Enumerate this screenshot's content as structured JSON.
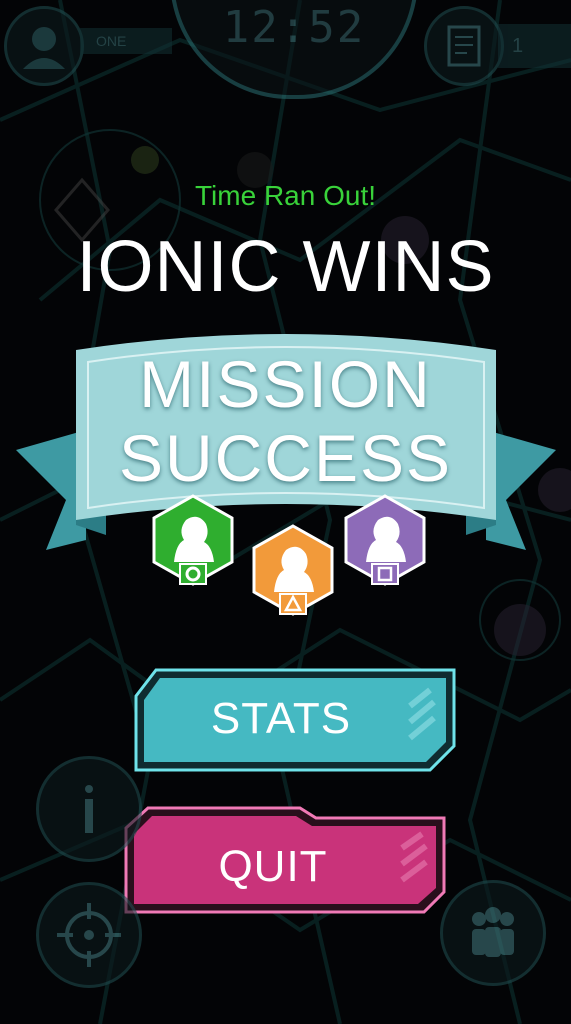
{
  "hud": {
    "clock": "12:52",
    "left_tag": "ONE",
    "right_tag": "1"
  },
  "result": {
    "reason": "Time Ran Out!",
    "winner": "IONIC WINS"
  },
  "banner": {
    "line1": "MISSION",
    "line2": "SUCCESS"
  },
  "badges": [
    {
      "shape_icon": "circle-icon",
      "color": "#2fae2f"
    },
    {
      "shape_icon": "triangle-icon",
      "color": "#f29a3a"
    },
    {
      "shape_icon": "square-icon",
      "color": "#8d6bb8"
    }
  ],
  "buttons": {
    "stats": "STATS",
    "quit": "QUIT"
  },
  "colors": {
    "teal": "#45b9c2",
    "pink": "#c9337a",
    "green_text": "#39d23a"
  }
}
